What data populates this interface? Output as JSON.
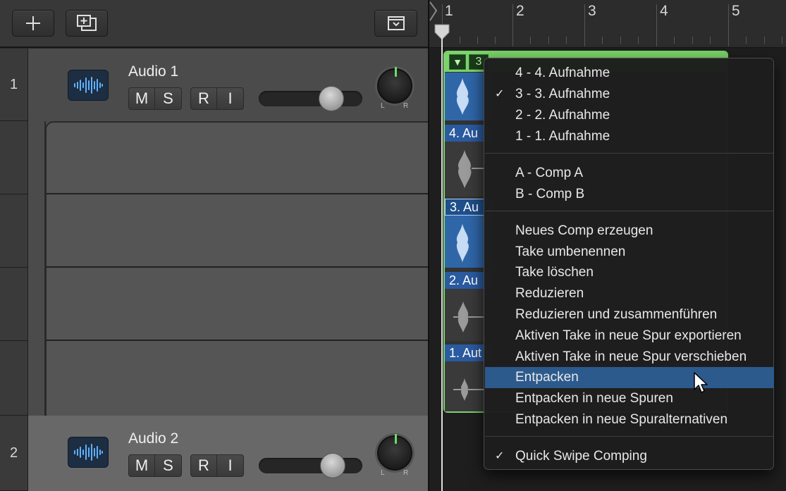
{
  "toolbar": {
    "add_icon": "plus-icon",
    "new_track_icon": "add-track-duplicate-icon",
    "collapse_icon": "chevron-down-box-icon"
  },
  "tracks": [
    {
      "number": "1",
      "name": "Audio 1",
      "mute": "M",
      "solo": "S",
      "record": "R",
      "input": "I",
      "pan_l": "L",
      "pan_r": "R"
    },
    {
      "number": "2",
      "name": "Audio 2",
      "mute": "M",
      "solo": "S",
      "record": "R",
      "input": "I",
      "pan_l": "L",
      "pan_r": "R"
    }
  ],
  "ruler": {
    "bars": [
      "1",
      "2",
      "3",
      "4",
      "5"
    ]
  },
  "take_folder": {
    "badge": "3"
  },
  "takes": [
    {
      "label": "4. Au"
    },
    {
      "label": "3. Au"
    },
    {
      "label": "2. Au"
    },
    {
      "label": "1. Aut"
    }
  ],
  "menu": {
    "takes": [
      {
        "label": "4 - 4. Aufnahme",
        "checked": false
      },
      {
        "label": "3 - 3. Aufnahme",
        "checked": true
      },
      {
        "label": "2 - 2. Aufnahme",
        "checked": false
      },
      {
        "label": "1 - 1. Aufnahme",
        "checked": false
      }
    ],
    "comps": [
      {
        "label": "A - Comp A"
      },
      {
        "label": "B - Comp B"
      }
    ],
    "actions": [
      {
        "label": "Neues Comp erzeugen"
      },
      {
        "label": "Take umbenennen"
      },
      {
        "label": "Take löschen"
      },
      {
        "label": "Reduzieren"
      },
      {
        "label": "Reduzieren und zusammenführen"
      },
      {
        "label": "Aktiven Take in neue Spur exportieren"
      },
      {
        "label": "Aktiven Take in neue Spur verschieben"
      },
      {
        "label": "Entpacken",
        "highlighted": true
      },
      {
        "label": "Entpacken in neue Spuren"
      },
      {
        "label": "Entpacken in neue Spuralternativen"
      }
    ],
    "quick_swipe": {
      "label": "Quick Swipe Comping",
      "checked": true
    },
    "check_glyph": "✓"
  },
  "colors": {
    "highlight": "#2c5a8d",
    "take_region": "#2f66a8",
    "folder_green": "#7bd36b",
    "pan_indicator": "#6ddc6f"
  }
}
